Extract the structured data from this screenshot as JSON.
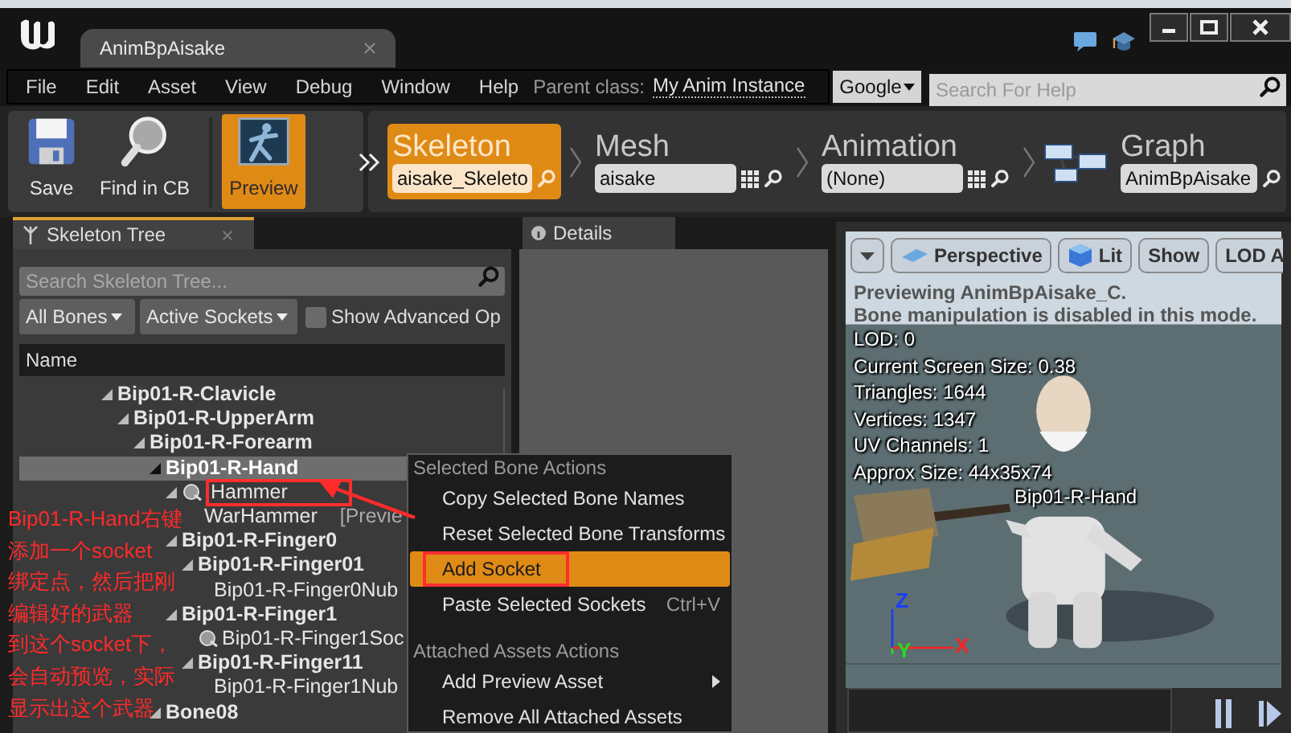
{
  "window": {
    "tab_title": "AnimBpAisake"
  },
  "menu_bar": {
    "items": [
      "File",
      "Edit",
      "Asset",
      "View",
      "Debug",
      "Window",
      "Help"
    ],
    "parent_class_label": "Parent class:",
    "parent_class_value": "My Anim Instance"
  },
  "help_search": {
    "provider": "Google",
    "placeholder": "Search For Help"
  },
  "toolbar": [
    {
      "label": "Save",
      "kind": "save",
      "selected": false
    },
    {
      "label": "Find in CB",
      "kind": "find",
      "selected": false
    },
    {
      "label": "Preview",
      "kind": "preview",
      "selected": true
    }
  ],
  "modes": [
    {
      "label": "Skeleton",
      "value": "aisake_Skeleto",
      "kind": "asset",
      "browse": false,
      "selected": true
    },
    {
      "label": "Mesh",
      "value": "aisake",
      "kind": "asset",
      "browse": true,
      "selected": false
    },
    {
      "label": "Animation",
      "value": "(None)",
      "kind": "asset",
      "browse": true,
      "selected": false
    },
    {
      "label": "Graph",
      "value": "AnimBpAisake",
      "kind": "graph",
      "browse": false,
      "selected": false
    }
  ],
  "skeleton_tree": {
    "tab_title": "Skeleton Tree",
    "search_placeholder": "Search Skeleton Tree...",
    "filters": [
      "All Bones",
      "Active Sockets"
    ],
    "show_advanced": {
      "label": "Show Advanced Op",
      "checked": false
    },
    "column": "Name",
    "bones": [
      {
        "name": "Bip01-R-Clavicle",
        "kind": "bone",
        "expanded": true,
        "selected": false,
        "annotated": false,
        "children": [
          {
            "name": "Bip01-R-UpperArm",
            "kind": "bone",
            "expanded": true,
            "selected": false,
            "annotated": false,
            "children": [
              {
                "name": "Bip01-R-Forearm",
                "kind": "bone",
                "expanded": true,
                "selected": false,
                "annotated": false,
                "children": [
                  {
                    "name": "Bip01-R-Hand",
                    "kind": "bone",
                    "expanded": true,
                    "selected": true,
                    "annotated": false,
                    "children": [
                      {
                        "name": "Hammer",
                        "kind": "socket",
                        "expanded": true,
                        "selected": false,
                        "annotated": true,
                        "children": [
                          {
                            "name": "WarHammer",
                            "kind": "asset",
                            "note": "[Previe",
                            "expanded": false,
                            "selected": false,
                            "annotated": false
                          }
                        ]
                      },
                      {
                        "name": "Bip01-R-Finger0",
                        "kind": "bone",
                        "expanded": true,
                        "selected": false,
                        "annotated": false,
                        "children": [
                          {
                            "name": "Bip01-R-Finger01",
                            "kind": "bone",
                            "expanded": true,
                            "selected": false,
                            "annotated": false,
                            "children": [
                              {
                                "name": "Bip01-R-Finger0Nub",
                                "kind": "bone",
                                "expanded": false,
                                "selected": false,
                                "annotated": false
                              }
                            ]
                          }
                        ]
                      },
                      {
                        "name": "Bip01-R-Finger1",
                        "kind": "bone",
                        "expanded": true,
                        "selected": false,
                        "annotated": false,
                        "children": [
                          {
                            "name": "Bip01-R-Finger1Soc",
                            "kind": "socket",
                            "expanded": false,
                            "selected": false,
                            "annotated": false
                          },
                          {
                            "name": "Bip01-R-Finger11",
                            "kind": "bone",
                            "expanded": true,
                            "selected": false,
                            "annotated": false,
                            "children": [
                              {
                                "name": "Bip01-R-Finger1Nub",
                                "kind": "bone",
                                "expanded": false,
                                "selected": false,
                                "annotated": false
                              }
                            ]
                          }
                        ]
                      }
                    ]
                  },
                  {
                    "name": "Bone08",
                    "kind": "bone",
                    "expanded": true,
                    "selected": false,
                    "annotated": false
                  }
                ]
              }
            ]
          }
        ]
      }
    ]
  },
  "details": {
    "tab_title": "Details"
  },
  "context_menu": {
    "sections": [
      {
        "header": "Selected Bone Actions",
        "items": [
          {
            "label": "Copy Selected Bone Names",
            "selected": false,
            "annotated": false,
            "submenu": false
          },
          {
            "label": "Reset Selected Bone Transforms",
            "selected": false,
            "annotated": false,
            "submenu": false
          },
          {
            "label": "Add Socket",
            "selected": true,
            "annotated": true,
            "submenu": false
          },
          {
            "label": "Paste Selected Sockets",
            "shortcut": "Ctrl+V",
            "selected": false,
            "annotated": false,
            "submenu": false
          }
        ]
      },
      {
        "header": "Attached Assets Actions",
        "items": [
          {
            "label": "Add Preview Asset",
            "selected": false,
            "annotated": false,
            "submenu": true
          },
          {
            "label": "Remove All Attached Assets",
            "selected": false,
            "annotated": false,
            "submenu": false
          }
        ]
      }
    ]
  },
  "viewport": {
    "buttons": [
      {
        "kind": "menu"
      },
      {
        "kind": "perspective",
        "label": "Perspective"
      },
      {
        "kind": "lit",
        "label": "Lit"
      },
      {
        "kind": "plain",
        "label": "Show"
      },
      {
        "kind": "plain",
        "label": "LOD A"
      }
    ],
    "notices": [
      "Previewing AnimBpAisake_C.",
      "Bone manipulation is disabled in this mode."
    ],
    "stats": [
      "LOD: 0",
      "Current Screen Size: 0.38",
      "Triangles: 1644",
      "Vertices: 1347",
      "UV Channels: 1",
      "Approx Size: 44x35x74"
    ],
    "bone_label": "Bip01-R-Hand",
    "axes": [
      {
        "label": "Z",
        "color": "#1a3cff"
      },
      {
        "label": "Y",
        "color": "#22dd22"
      },
      {
        "label": "X",
        "color": "#ff2222"
      }
    ]
  },
  "annotation": {
    "lines": [
      "Bip01-R-Hand右键",
      "添加一个socket",
      "绑定点，然后把刚",
      "编辑好的武器",
      "到这个socket下，",
      "会自动预览，实际",
      "显示出这个武器"
    ]
  }
}
